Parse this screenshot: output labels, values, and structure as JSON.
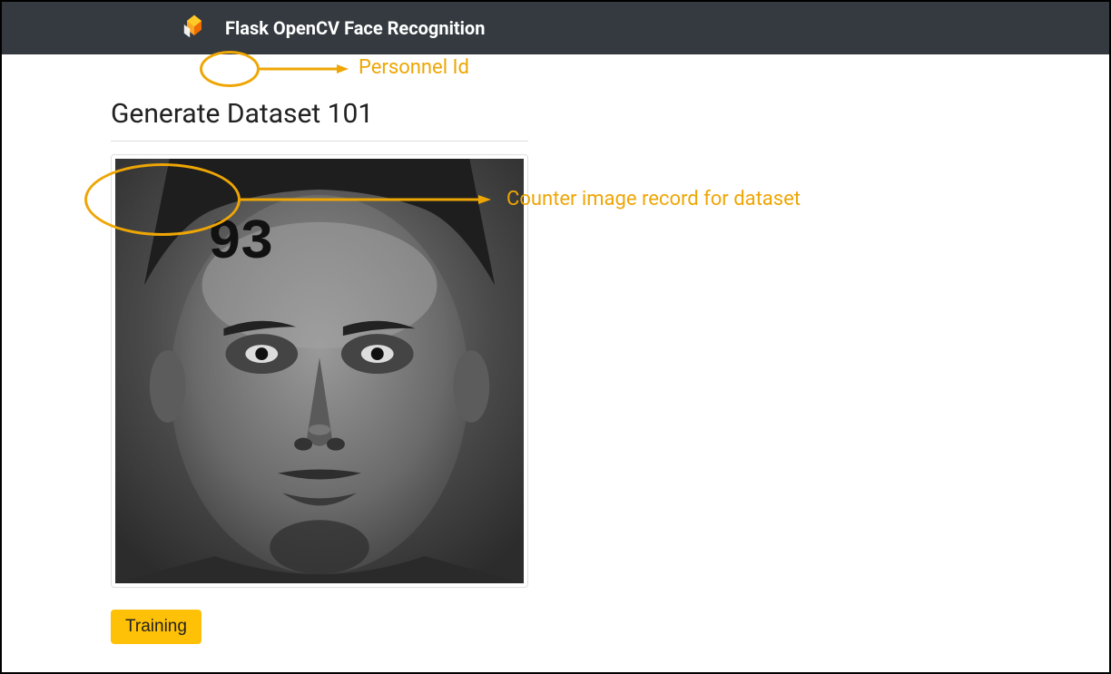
{
  "navbar": {
    "title": "Flask OpenCV Face Recognition"
  },
  "heading": {
    "prefix": "Generate Dataset ",
    "personnel_id": "101"
  },
  "camera": {
    "counter": "93"
  },
  "buttons": {
    "training": "Training"
  },
  "annotations": {
    "personnel_id_label": "Personnel Id",
    "counter_label": "Counter image record for dataset"
  }
}
